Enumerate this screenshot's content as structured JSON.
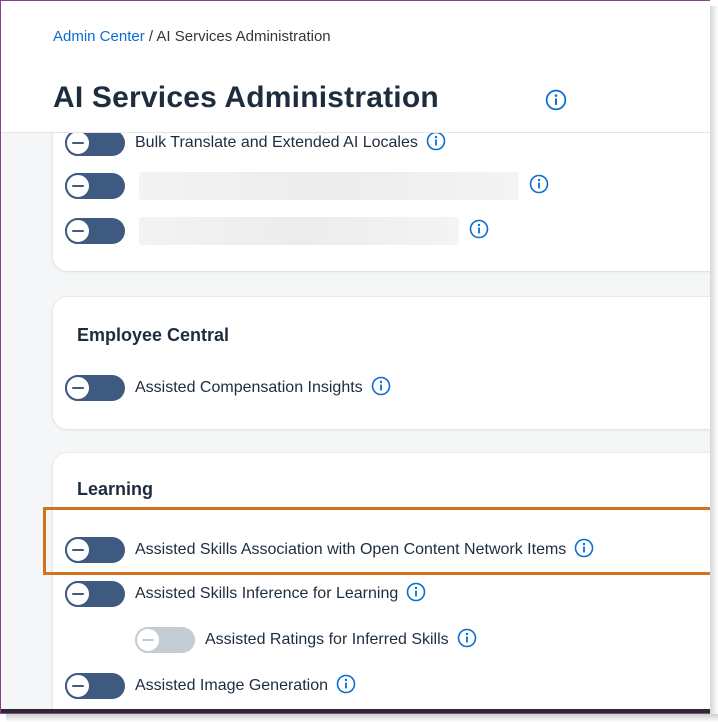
{
  "breadcrumb": {
    "parent": "Admin Center",
    "separator": " / ",
    "current": "AI Services Administration"
  },
  "page": {
    "title": "AI Services Administration"
  },
  "sections": {
    "general": {
      "items": [
        {
          "label": "Bulk Translate and Extended AI Locales",
          "state": "off"
        },
        {
          "label": "",
          "state": "off",
          "redacted": true
        },
        {
          "label": "",
          "state": "off",
          "redacted": true
        }
      ]
    },
    "employee_central": {
      "title": "Employee Central",
      "items": [
        {
          "label": "Assisted Compensation Insights",
          "state": "off"
        }
      ]
    },
    "learning": {
      "title": "Learning",
      "items": [
        {
          "label": "Assisted Skills Association with Open Content Network Items",
          "state": "off",
          "highlighted": true
        },
        {
          "label": "Assisted Skills Inference for Learning",
          "state": "off"
        },
        {
          "label": "Assisted Ratings for Inferred Skills",
          "state": "off",
          "disabled": true
        },
        {
          "label": "Assisted Image Generation",
          "state": "off"
        }
      ]
    }
  },
  "colors": {
    "link": "#0a6ed1",
    "toggle_off": "#3f5a80",
    "toggle_disabled": "#c4ccd6",
    "info_icon": "#0a6ed1",
    "highlight": "#d0731c",
    "frame": "#8c3d8f"
  },
  "icons": {
    "info": "info-circle-icon"
  }
}
